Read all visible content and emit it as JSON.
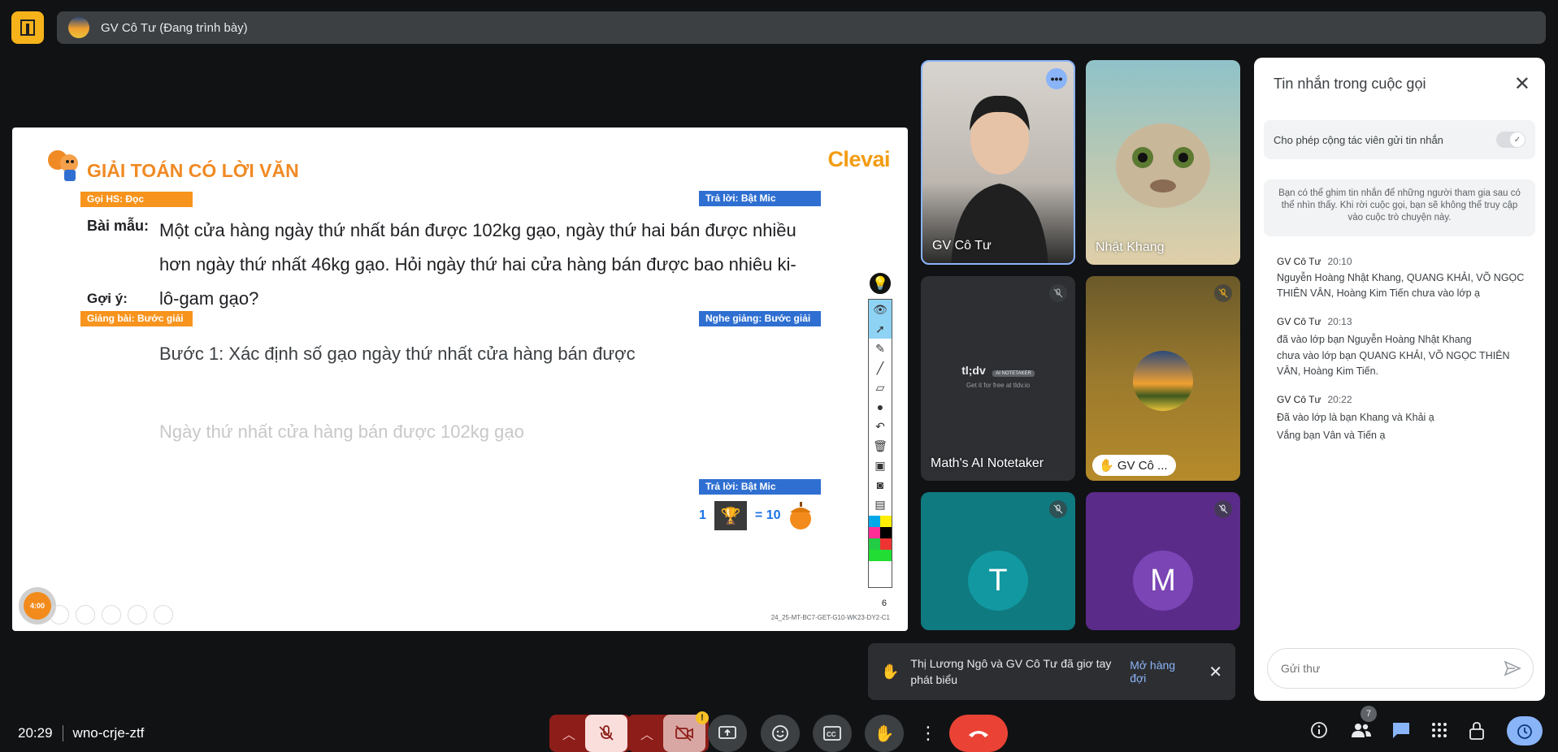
{
  "presenter_bar": {
    "name": "GV Cô Tư (Đang trình bày)"
  },
  "slide": {
    "title": "GIẢI TOÁN CÓ LỜI VĂN",
    "brand": "Clevai",
    "tags": {
      "goi_hs": "Gọi HS: Đọc",
      "tra_loi_1": "Trả lời: Bật Mic",
      "giang_bai": "Giảng bài: Bước giải",
      "nghe_giang": "Nghe giảng: Bước giải",
      "tra_loi_2": "Trả lời: Bật Mic"
    },
    "bai_mau_label": "Bài mẫu:",
    "goi_y_label": "Gợi ý:",
    "problem_lines": [
      "Một cửa hàng ngày thứ nhất bán được 102kg gạo, ngày thứ hai bán được nhiều",
      "hơn ngày thứ nhất 46kg gạo. Hỏi ngày thứ hai cửa hàng bán được bao nhiêu ki-",
      "lô-gam gạo?"
    ],
    "step1": "Bước 1: Xác định số gạo ngày thứ nhất cửa hàng bán được",
    "hint_answer": "Ngày thứ nhất cửa hàng bán được 102kg gạo",
    "score": {
      "count": "1",
      "equals": "= 10"
    },
    "page_number": "6",
    "slide_code": "24_25-MT-BC7-GET-G10-WK23-DY2-C1",
    "timer": "4:00"
  },
  "tiles": [
    {
      "name": "GV Cô Tư"
    },
    {
      "name": "Nhật Khang"
    },
    {
      "name": "Math's AI Notetaker",
      "logo": "tl;dv",
      "logo_badge": "AI NOTETAKER",
      "logo_sub": "Get it for free at tldv.io"
    },
    {
      "name": "GV Cô ..."
    },
    {
      "initial": "T"
    },
    {
      "initial": "M"
    }
  ],
  "chat": {
    "title": "Tin nhắn trong cuộc gọi",
    "toggle_label": "Cho phép cộng tác viên gửi tin nhắn",
    "info": "Bạn có thể ghim tin nhắn để những người tham gia sau có thể nhìn thấy. Khi rời cuộc gọi, bạn sẽ không thể truy cập vào cuộc trò chuyện này.",
    "messages": [
      {
        "sender": "GV Cô Tư",
        "time": "20:10",
        "lines": [
          "Nguyễn Hoàng Nhật Khang, QUANG KHẢI, VÕ NGỌC THIÊN VÂN, Hoàng Kim Tiến chưa vào lớp ạ"
        ]
      },
      {
        "sender": "GV Cô Tư",
        "time": "20:13",
        "lines": [
          "đã vào lớp bạn Nguyễn Hoàng Nhật Khang",
          "chưa vào lớp bạn QUANG KHẢI, VÕ NGỌC THIÊN VÂN, Hoàng Kim Tiến."
        ]
      },
      {
        "sender": "GV Cô Tư",
        "time": "20:22",
        "lines": [
          "Đã vào lớp là bạn Khang và Khải ạ",
          "Vắng bạn Vân và Tiến ạ"
        ]
      }
    ],
    "input_placeholder": "Gửi thư"
  },
  "toast": {
    "text": "Thị Lương Ngô và GV Cô Tư đã giơ tay phát biểu",
    "action": "Mở hàng đợi"
  },
  "bottom": {
    "time": "20:29",
    "meeting_code": "wno-crje-ztf",
    "participants_count": "7"
  },
  "colors": {
    "accent_orange": "#f7941d",
    "accent_blue": "#2f6fd1",
    "end_call": "#ea4335",
    "muted_red": "#f9dedc"
  }
}
